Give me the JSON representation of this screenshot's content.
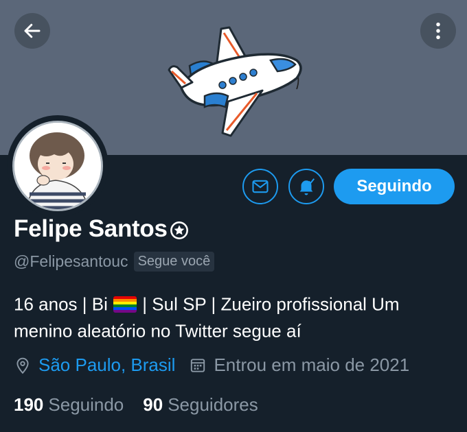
{
  "profile": {
    "name": "Felipe Santos",
    "handle": "@Felipesantouc",
    "follows_you": "Segue você",
    "bio_part1": "16 anos | Bi ",
    "bio_part2": " | Sul SP | Zueiro profissional Um menino aleatório no Twitter segue aí",
    "location": "São Paulo, Brasil",
    "joined": "Entrou em maio de 2021",
    "following_count": "190",
    "following_label": "Seguindo",
    "followers_count": "90",
    "followers_label": "Seguidores"
  },
  "actions": {
    "follow_label": "Seguindo"
  },
  "icons": {
    "back": "arrow-left-icon",
    "more": "more-vertical-icon",
    "message": "envelope-icon",
    "notifications": "bell-icon",
    "name_badge": "circled-star-icon",
    "location": "map-pin-icon",
    "joined": "calendar-icon"
  },
  "colors": {
    "background": "#15202b",
    "banner": "#5b6779",
    "accent": "#1d9bf0",
    "secondary_text": "#8b98a5"
  }
}
